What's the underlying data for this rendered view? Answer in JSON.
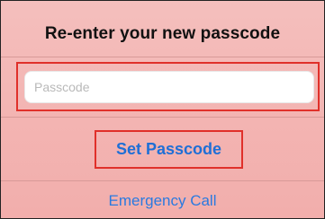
{
  "dialog": {
    "title": "Re-enter your new passcode",
    "passcode_placeholder": "Passcode",
    "passcode_value": "",
    "set_button_label": "Set Passcode",
    "emergency_label": "Emergency Call"
  },
  "colors": {
    "background": "#f3b5b3",
    "highlight_border": "#e0302a",
    "link_blue": "#1f6fd6",
    "title_text": "#111111"
  }
}
